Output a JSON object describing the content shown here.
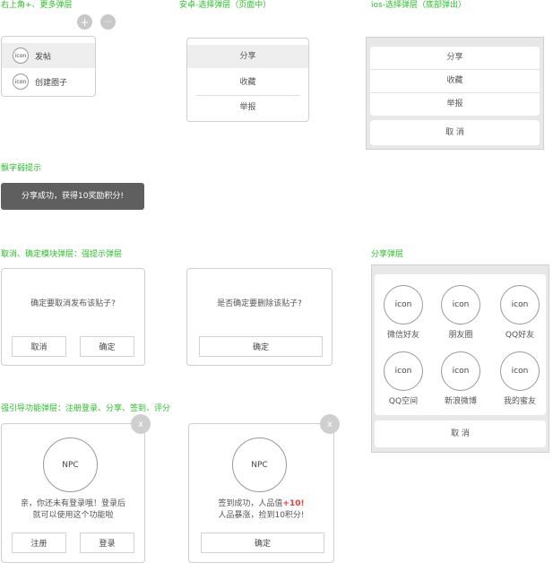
{
  "sections": {
    "top_right_menu": "右上角+、更多弹层",
    "android_select": "安卓-选择弹层（页面中）",
    "ios_select": "ios-选择弹层（底部弹出）",
    "toast": "飘字弱提示",
    "confirm": "取消、确定模块弹层：强提示弹层",
    "share": "分享弹层",
    "guide": "强引导功能弹层：注册登录、分享、签到、评分"
  },
  "top_menu": {
    "plus_icon": "+",
    "more_icon": "···",
    "items": [
      {
        "icon": "icon",
        "label": "发帖"
      },
      {
        "icon": "icon",
        "label": "创建圈子"
      }
    ]
  },
  "android_sheet": {
    "items": [
      "分享",
      "收藏",
      "举报"
    ]
  },
  "ios_sheet": {
    "items": [
      "分享",
      "收藏",
      "举报"
    ],
    "cancel": "取 消"
  },
  "toast": {
    "text": "分享成功，获得10奖励积分!"
  },
  "confirm_dialog_1": {
    "message": "确定要取消发布该贴子?",
    "cancel": "取消",
    "ok": "确定"
  },
  "confirm_dialog_2": {
    "message": "是否确定要删除该贴子?",
    "ok": "确定"
  },
  "share_sheet": {
    "items": [
      {
        "icon": "icon",
        "label": "微信好友"
      },
      {
        "icon": "icon",
        "label": "朋友圈"
      },
      {
        "icon": "icon",
        "label": "QQ好友"
      },
      {
        "icon": "icon",
        "label": "QQ空间"
      },
      {
        "icon": "icon",
        "label": "新浪微博"
      },
      {
        "icon": "icon",
        "label": "我的蜜友"
      }
    ],
    "cancel": "取 消"
  },
  "guide_login": {
    "close": "x",
    "avatar": "NPC",
    "line1": "亲，你还未有登录哦！登录后",
    "line2": "就可以使用这个功能啦",
    "register": "注册",
    "login": "登录"
  },
  "guide_signin": {
    "close": "x",
    "avatar": "NPC",
    "line1_prefix": "签到成功，人品值",
    "line1_highlight": "+10!",
    "line2": "人品暴涨，捡到10积分!",
    "ok": "确定"
  },
  "colors": {
    "section_title": "#2bbf2b",
    "toast_bg": "#5f5f5f",
    "highlight_red": "#e03c3c",
    "panel_bg": "#e8e8e8"
  }
}
